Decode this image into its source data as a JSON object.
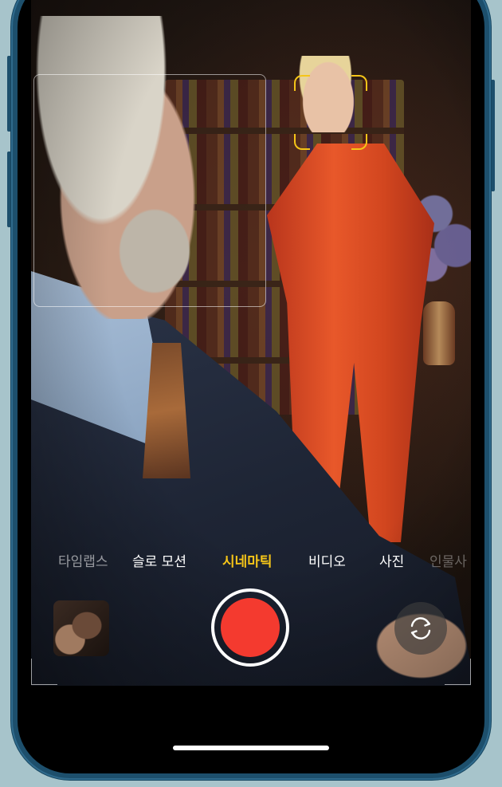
{
  "app": "Camera",
  "colors": {
    "accent_yellow": "#f5c518",
    "record_red": "#f43a2f",
    "frame_blue": "#1d4f6c",
    "background": "#a7c4cb"
  },
  "modes": [
    {
      "label": "타임랩스",
      "state": "faded"
    },
    {
      "label": "슬로 모션",
      "state": "normal"
    },
    {
      "label": "시네마틱",
      "state": "active"
    },
    {
      "label": "비디오",
      "state": "normal"
    },
    {
      "label": "사진",
      "state": "normal"
    },
    {
      "label": "인물사",
      "state": "fade-right"
    }
  ],
  "controls": {
    "shutter": "record-button",
    "thumbnail": "last-capture-thumbnail",
    "flip": "flip-camera-icon"
  }
}
